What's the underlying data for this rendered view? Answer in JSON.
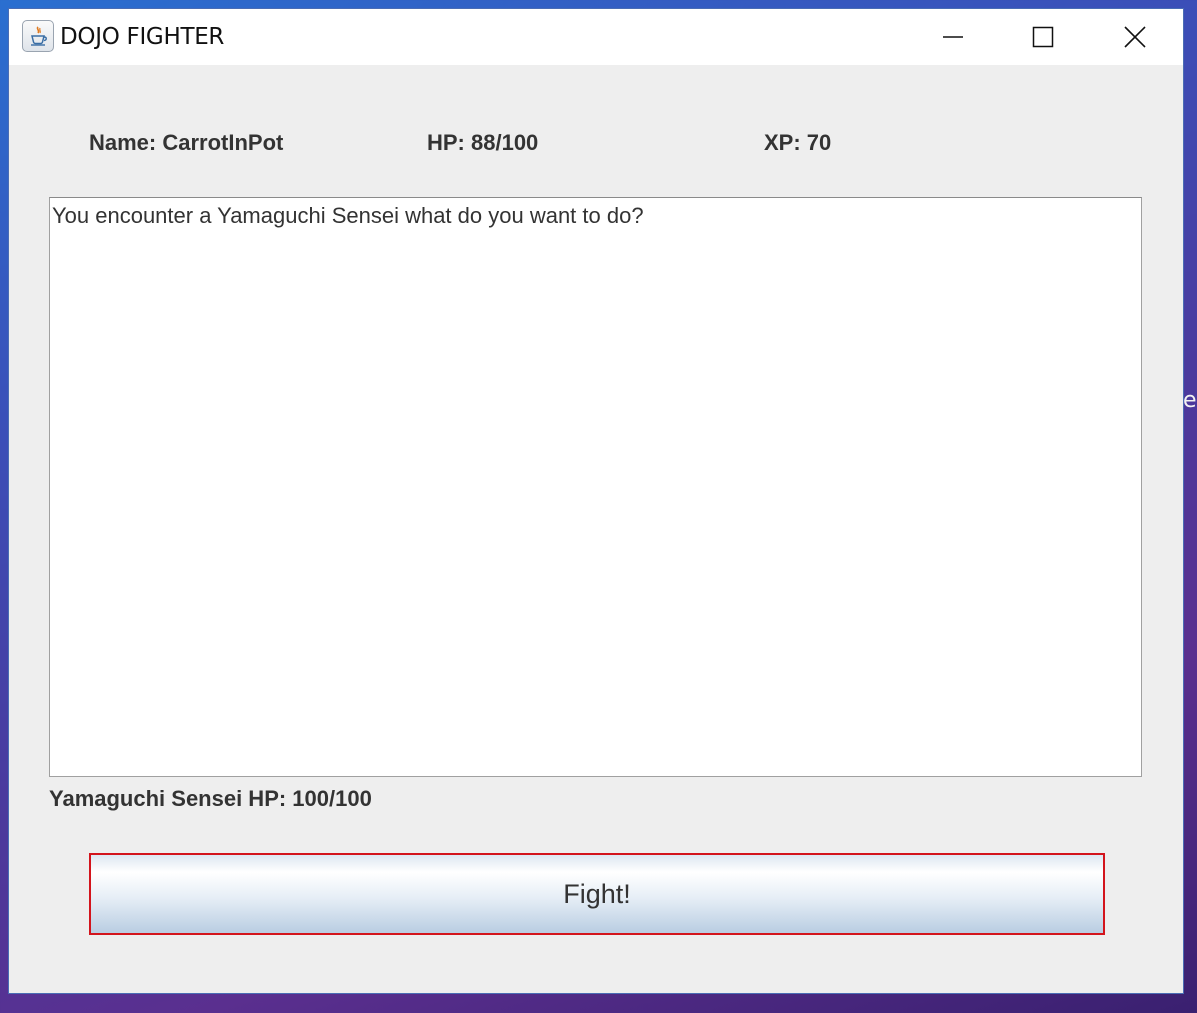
{
  "window": {
    "title": "DOJO FIGHTER",
    "app_icon": "java-cup-icon",
    "controls": [
      "minimize-icon",
      "maximize-icon",
      "close-icon"
    ]
  },
  "player": {
    "name_label": "Name: CarrotInPot",
    "hp_label": "HP: 88/100",
    "xp_label": "XP: 70"
  },
  "log": {
    "text": "You encounter a Yamaguchi Sensei what do you want to do?"
  },
  "enemy": {
    "hp_label": "Yamaguchi Sensei HP: 100/100"
  },
  "actions": {
    "fight_label": "Fight!"
  },
  "desktop": {
    "peek_text": "er"
  },
  "colors": {
    "fight_border": "#d3141c",
    "panel_bg": "#eeeeee"
  }
}
